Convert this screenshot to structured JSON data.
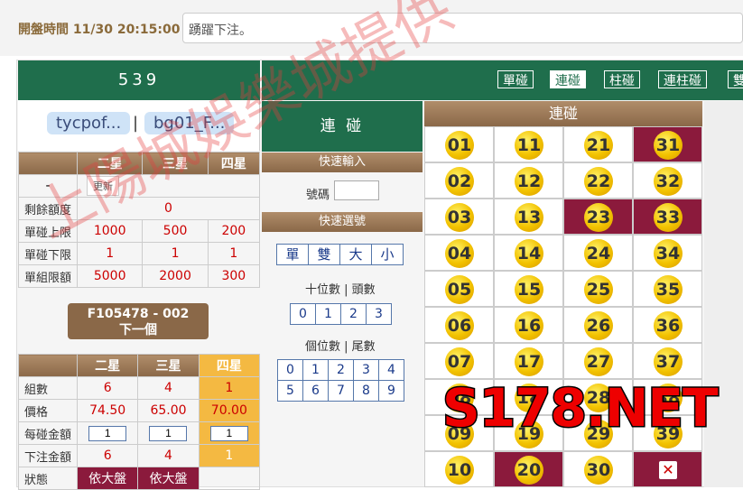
{
  "header": {
    "open_time_label": "開盤時間 11/30 20:15:00",
    "notice": "踴躍下注。"
  },
  "game": {
    "title": "539",
    "user1": "tycpof...",
    "user2": "bg01_F...",
    "sep": "|"
  },
  "limits_table": {
    "headers": [
      "二星",
      "三星",
      "四星"
    ],
    "refresh_label": "更新",
    "dash": "-",
    "rows": [
      {
        "label": "剩餘額度",
        "values": [
          "0"
        ]
      },
      {
        "label": "單碰上限",
        "values": [
          "1000",
          "500",
          "200"
        ]
      },
      {
        "label": "單碰下限",
        "values": [
          "1",
          "1",
          "1"
        ]
      },
      {
        "label": "單組限額",
        "values": [
          "5000",
          "2000",
          "300"
        ]
      }
    ]
  },
  "next_button": {
    "line1": "F105478 - 002",
    "line2": "下一個"
  },
  "bet_table": {
    "headers": [
      "二星",
      "三星",
      "四星"
    ],
    "rows": [
      {
        "label": "組數",
        "values": [
          "6",
          "4",
          "1"
        ]
      },
      {
        "label": "價格",
        "values": [
          "74.50",
          "65.00",
          "70.00"
        ]
      },
      {
        "label": "每碰金額",
        "values": [
          "1",
          "1",
          "1"
        ]
      },
      {
        "label": "下注金額",
        "values": [
          "6",
          "4",
          "1"
        ]
      },
      {
        "label": "狀態",
        "values": [
          "依大盤",
          "依大盤",
          ""
        ]
      }
    ]
  },
  "middle": {
    "title": "連 碰",
    "quick_input": "快速輸入",
    "code_label": "號碼",
    "quick_select": "快速選號",
    "quick_buttons": [
      "單",
      "雙",
      "大",
      "小"
    ],
    "tens_label": "十位數 | 頭數",
    "tens": [
      "0",
      "1",
      "2",
      "3"
    ],
    "units_label": "個位數 | 尾數",
    "units": [
      "0",
      "1",
      "2",
      "3",
      "4",
      "5",
      "6",
      "7",
      "8",
      "9"
    ]
  },
  "tabs": [
    "單碰",
    "連碰",
    "柱碰",
    "連柱碰",
    "雙"
  ],
  "numbers": {
    "header": "連碰",
    "columns": [
      [
        "01",
        "02",
        "03",
        "04",
        "05",
        "06",
        "07",
        "08",
        "09",
        "10"
      ],
      [
        "11",
        "12",
        "13",
        "14",
        "15",
        "16",
        "17",
        "18",
        "19",
        "20"
      ],
      [
        "21",
        "22",
        "23",
        "24",
        "25",
        "26",
        "27",
        "28",
        "29",
        "30"
      ],
      [
        "31",
        "32",
        "33",
        "34",
        "35",
        "36",
        "37",
        "38",
        "39",
        "x"
      ]
    ],
    "selected": [
      "31",
      "23",
      "33",
      "20",
      "x"
    ]
  },
  "watermark": {
    "text": "上陽城娛樂城提供",
    "brand": "S178.NET"
  },
  "colors": {
    "green": "#1f6e4c",
    "brown": "#8a6848",
    "maroon": "#8b1a3c",
    "ball": "#f2c200",
    "orange": "#f4b942"
  }
}
